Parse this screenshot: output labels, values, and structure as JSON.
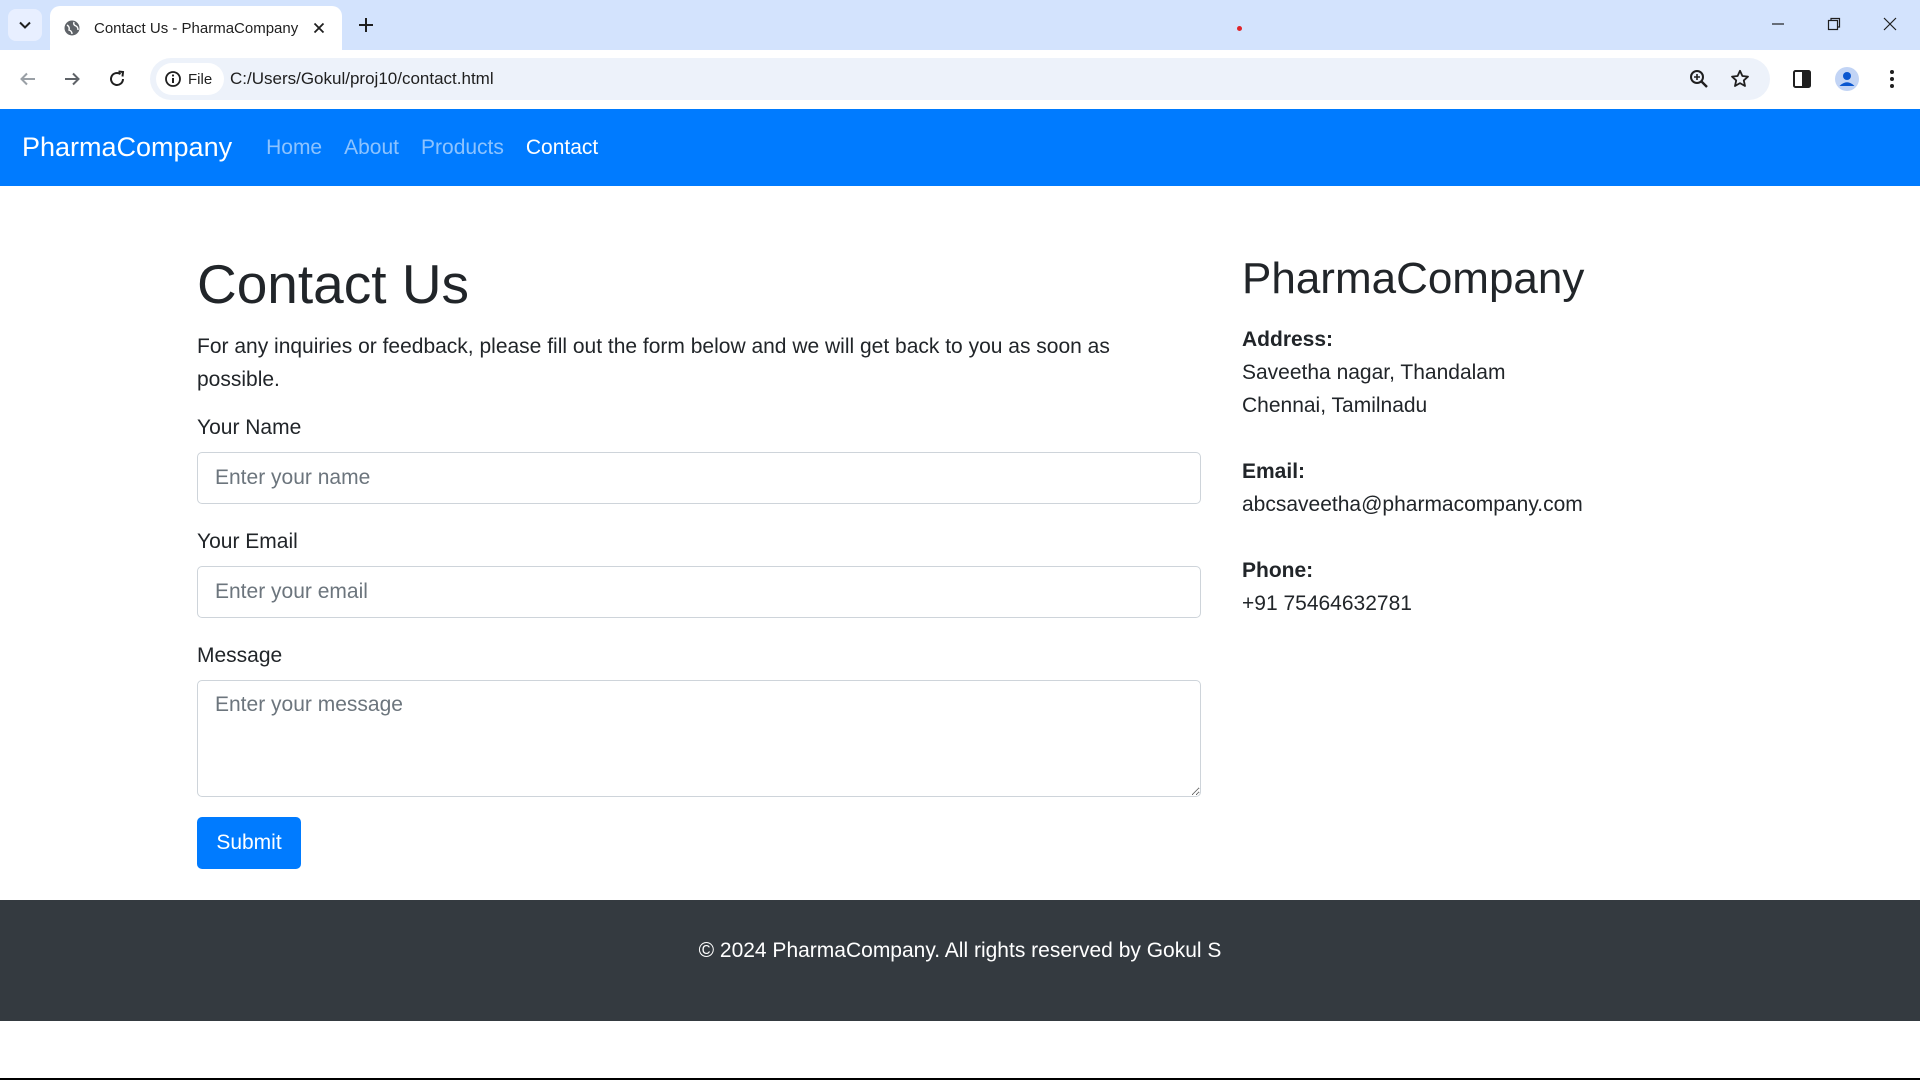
{
  "browser": {
    "tab_title": "Contact Us - PharmaCompany",
    "site_chip_label": "File",
    "url": "C:/Users/Gokul/proj10/contact.html",
    "icons": [
      "tab-search-icon",
      "globe-icon",
      "close-icon",
      "plus-icon",
      "minimize-icon",
      "restore-icon",
      "window-close-icon",
      "back-arrow-icon",
      "forward-arrow-icon",
      "reload-icon",
      "info-icon",
      "zoom-icon",
      "star-icon",
      "side-panel-icon",
      "profile-icon",
      "kebab-menu-icon"
    ]
  },
  "navbar": {
    "brand": "PharmaCompany",
    "links": [
      {
        "label": "Home",
        "active": false
      },
      {
        "label": "About",
        "active": false
      },
      {
        "label": "Products",
        "active": false
      },
      {
        "label": "Contact",
        "active": true
      }
    ],
    "color": "#007bff"
  },
  "contact": {
    "title": "Contact Us",
    "intro": "For any inquiries or feedback, please fill out the form below and we will get back to you as soon as possible.",
    "name_label": "Your Name",
    "name_placeholder": "Enter your name",
    "name_value": "",
    "email_label": "Your Email",
    "email_placeholder": "Enter your email",
    "email_value": "",
    "message_label": "Message",
    "message_placeholder": "Enter your message",
    "message_value": "",
    "submit_label": "Submit"
  },
  "company": {
    "name": "PharmaCompany",
    "address_label": "Address:",
    "address_line1": "Saveetha nagar, Thandalam",
    "address_line2": "Chennai, Tamilnadu",
    "email_label": "Email:",
    "email": "abcsaveetha@pharmacompany.com",
    "phone_label": "Phone:",
    "phone": "+91 75464632781"
  },
  "footer": {
    "text": "© 2024 PharmaCompany. All rights reserved by Gokul S",
    "color": "#343a40"
  }
}
